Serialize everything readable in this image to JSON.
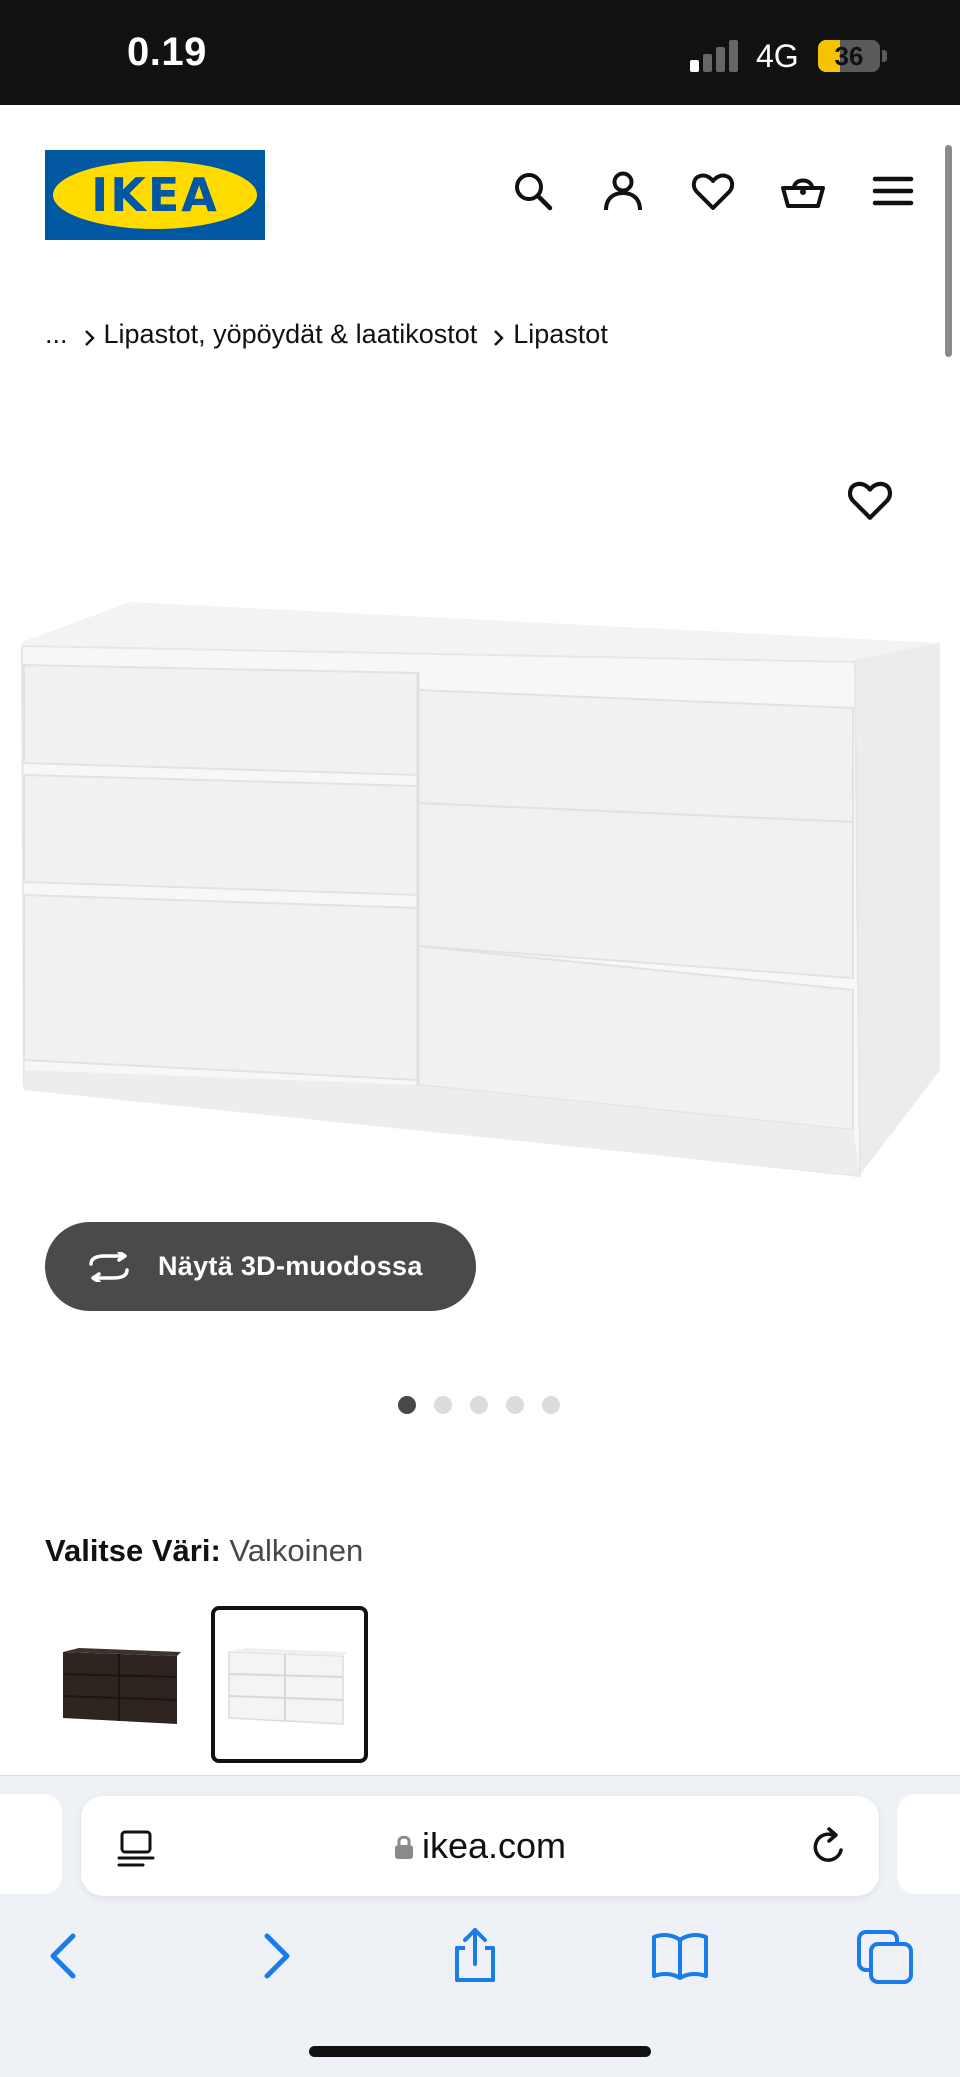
{
  "status_bar": {
    "time": "0.19",
    "network": "4G",
    "battery": "36",
    "battery_level": 0.36
  },
  "header": {
    "logo_text": "IKEA",
    "logo_reg": "®",
    "icons": [
      "search-icon",
      "account-icon",
      "favourites-icon",
      "cart-icon",
      "menu-icon"
    ]
  },
  "breadcrumb": {
    "ellipsis": "...",
    "items": [
      "Lipastot, yöpöydät & laatikostot",
      "Lipastot"
    ]
  },
  "product": {
    "image_alt_icon": "dresser-image",
    "view_3d_label": "Näytä 3D-muodossa",
    "image_count": 5,
    "active_image": 1
  },
  "color_select": {
    "label": "Valitse Väri:",
    "value": "Valkoinen",
    "options": [
      "dark",
      "white"
    ],
    "selected_index": 1
  },
  "browser": {
    "url": "ikea.com",
    "toolbar_icons": [
      "back-icon",
      "forward-icon",
      "share-icon",
      "bookmarks-icon",
      "tabs-icon"
    ]
  },
  "colors": {
    "ikea_blue": "#0058a3",
    "ikea_yellow": "#ffdb00",
    "safari_blue": "#1a7ce8"
  }
}
